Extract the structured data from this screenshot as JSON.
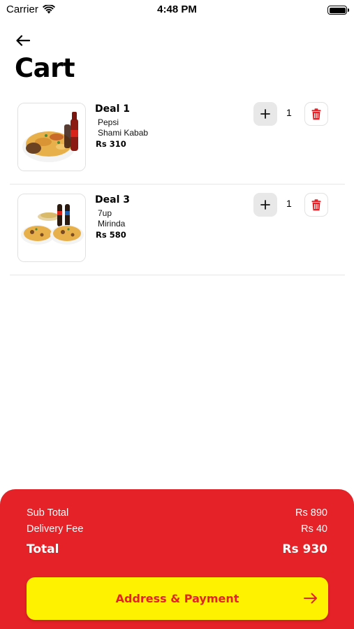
{
  "status_bar": {
    "carrier": "Carrier",
    "time": "4:48 PM"
  },
  "header": {
    "title": "Cart",
    "back_icon": "arrow-left-icon"
  },
  "cart": {
    "items": [
      {
        "name": "Deal 1",
        "desc_line1": "Pepsi",
        "desc_line2": "Shami Kabab",
        "price": "Rs 310",
        "quantity": "1"
      },
      {
        "name": "Deal 3",
        "desc_line1": "7up",
        "desc_line2": "Mirinda",
        "price": "Rs 580",
        "quantity": "1"
      }
    ]
  },
  "summary": {
    "subtotal_label": "Sub Total",
    "subtotal_value": "Rs 890",
    "delivery_label": "Delivery Fee",
    "delivery_value": "Rs 40",
    "total_label": "Total",
    "total_value": "Rs 930",
    "button_label": "Address & Payment"
  },
  "colors": {
    "brand_red": "#e52227",
    "brand_yellow": "#fef200",
    "stepper_gray": "#e8e8e8"
  }
}
